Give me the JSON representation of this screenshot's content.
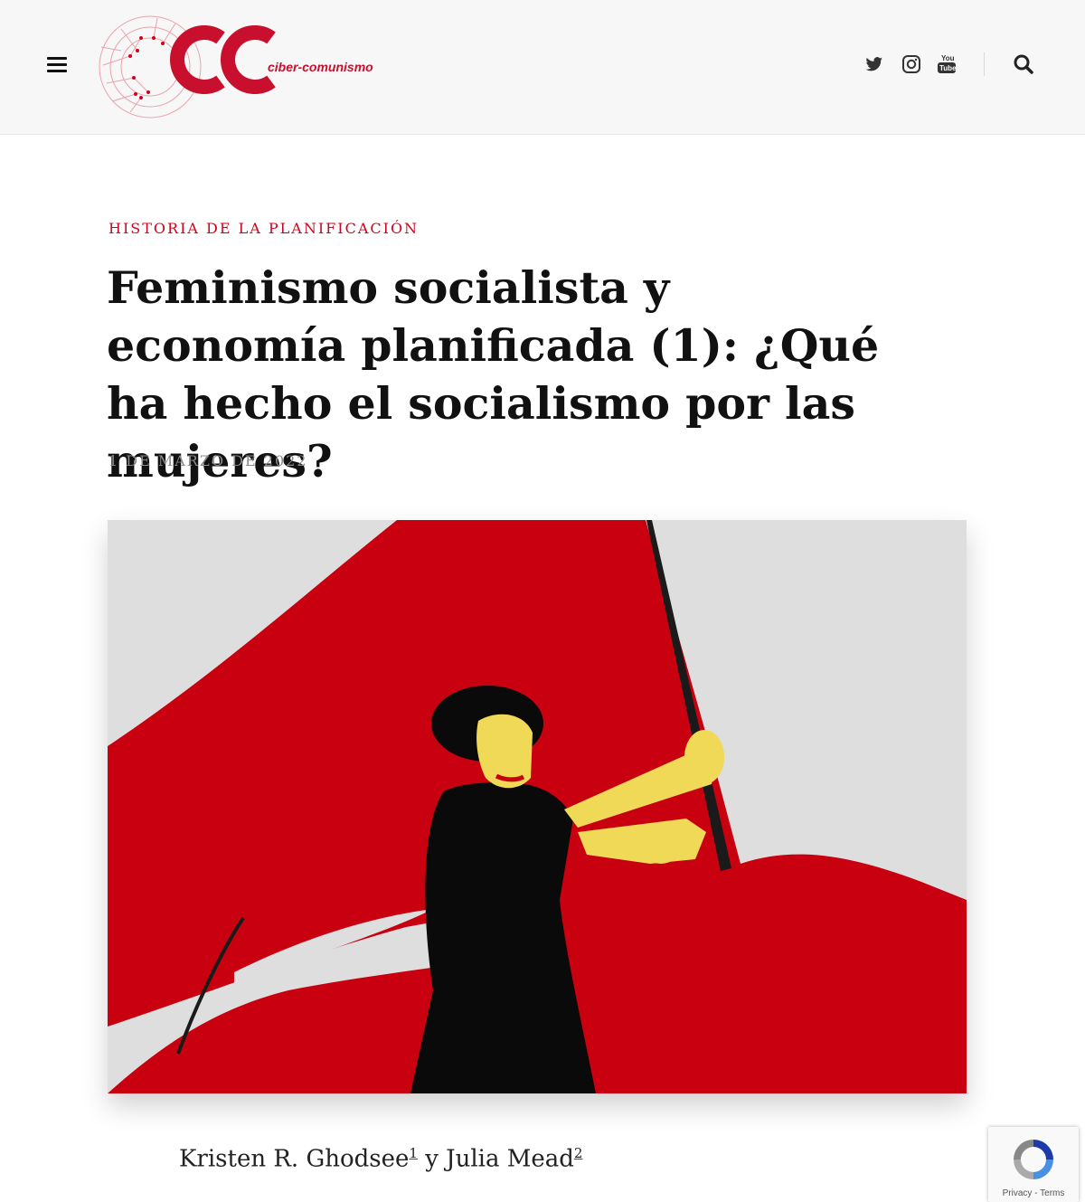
{
  "header": {
    "logo_text": "ciber-comunismo",
    "logo_mark": "CC",
    "icons": [
      "menu-icon",
      "twitter-icon",
      "instagram-icon",
      "youtube-icon",
      "search-icon"
    ]
  },
  "article": {
    "category": "HISTORIA DE LA PLANIFICACIÓN",
    "title": "Feminismo socialista y economía planificada (1): ¿Qué ha hecho el socialismo por las mujeres?",
    "date": "1 DE MARZO DE 2022",
    "authors": {
      "author1": "Kristen R. Ghodsee",
      "ref1": "1",
      "connector": " y ",
      "author2": "Julia Mead",
      "ref2": "2"
    }
  },
  "recaptcha": {
    "terms": "Privacy - Terms"
  },
  "colors": {
    "accent": "#d0021b",
    "flag": "#c8000f",
    "skin": "#f0d957"
  }
}
